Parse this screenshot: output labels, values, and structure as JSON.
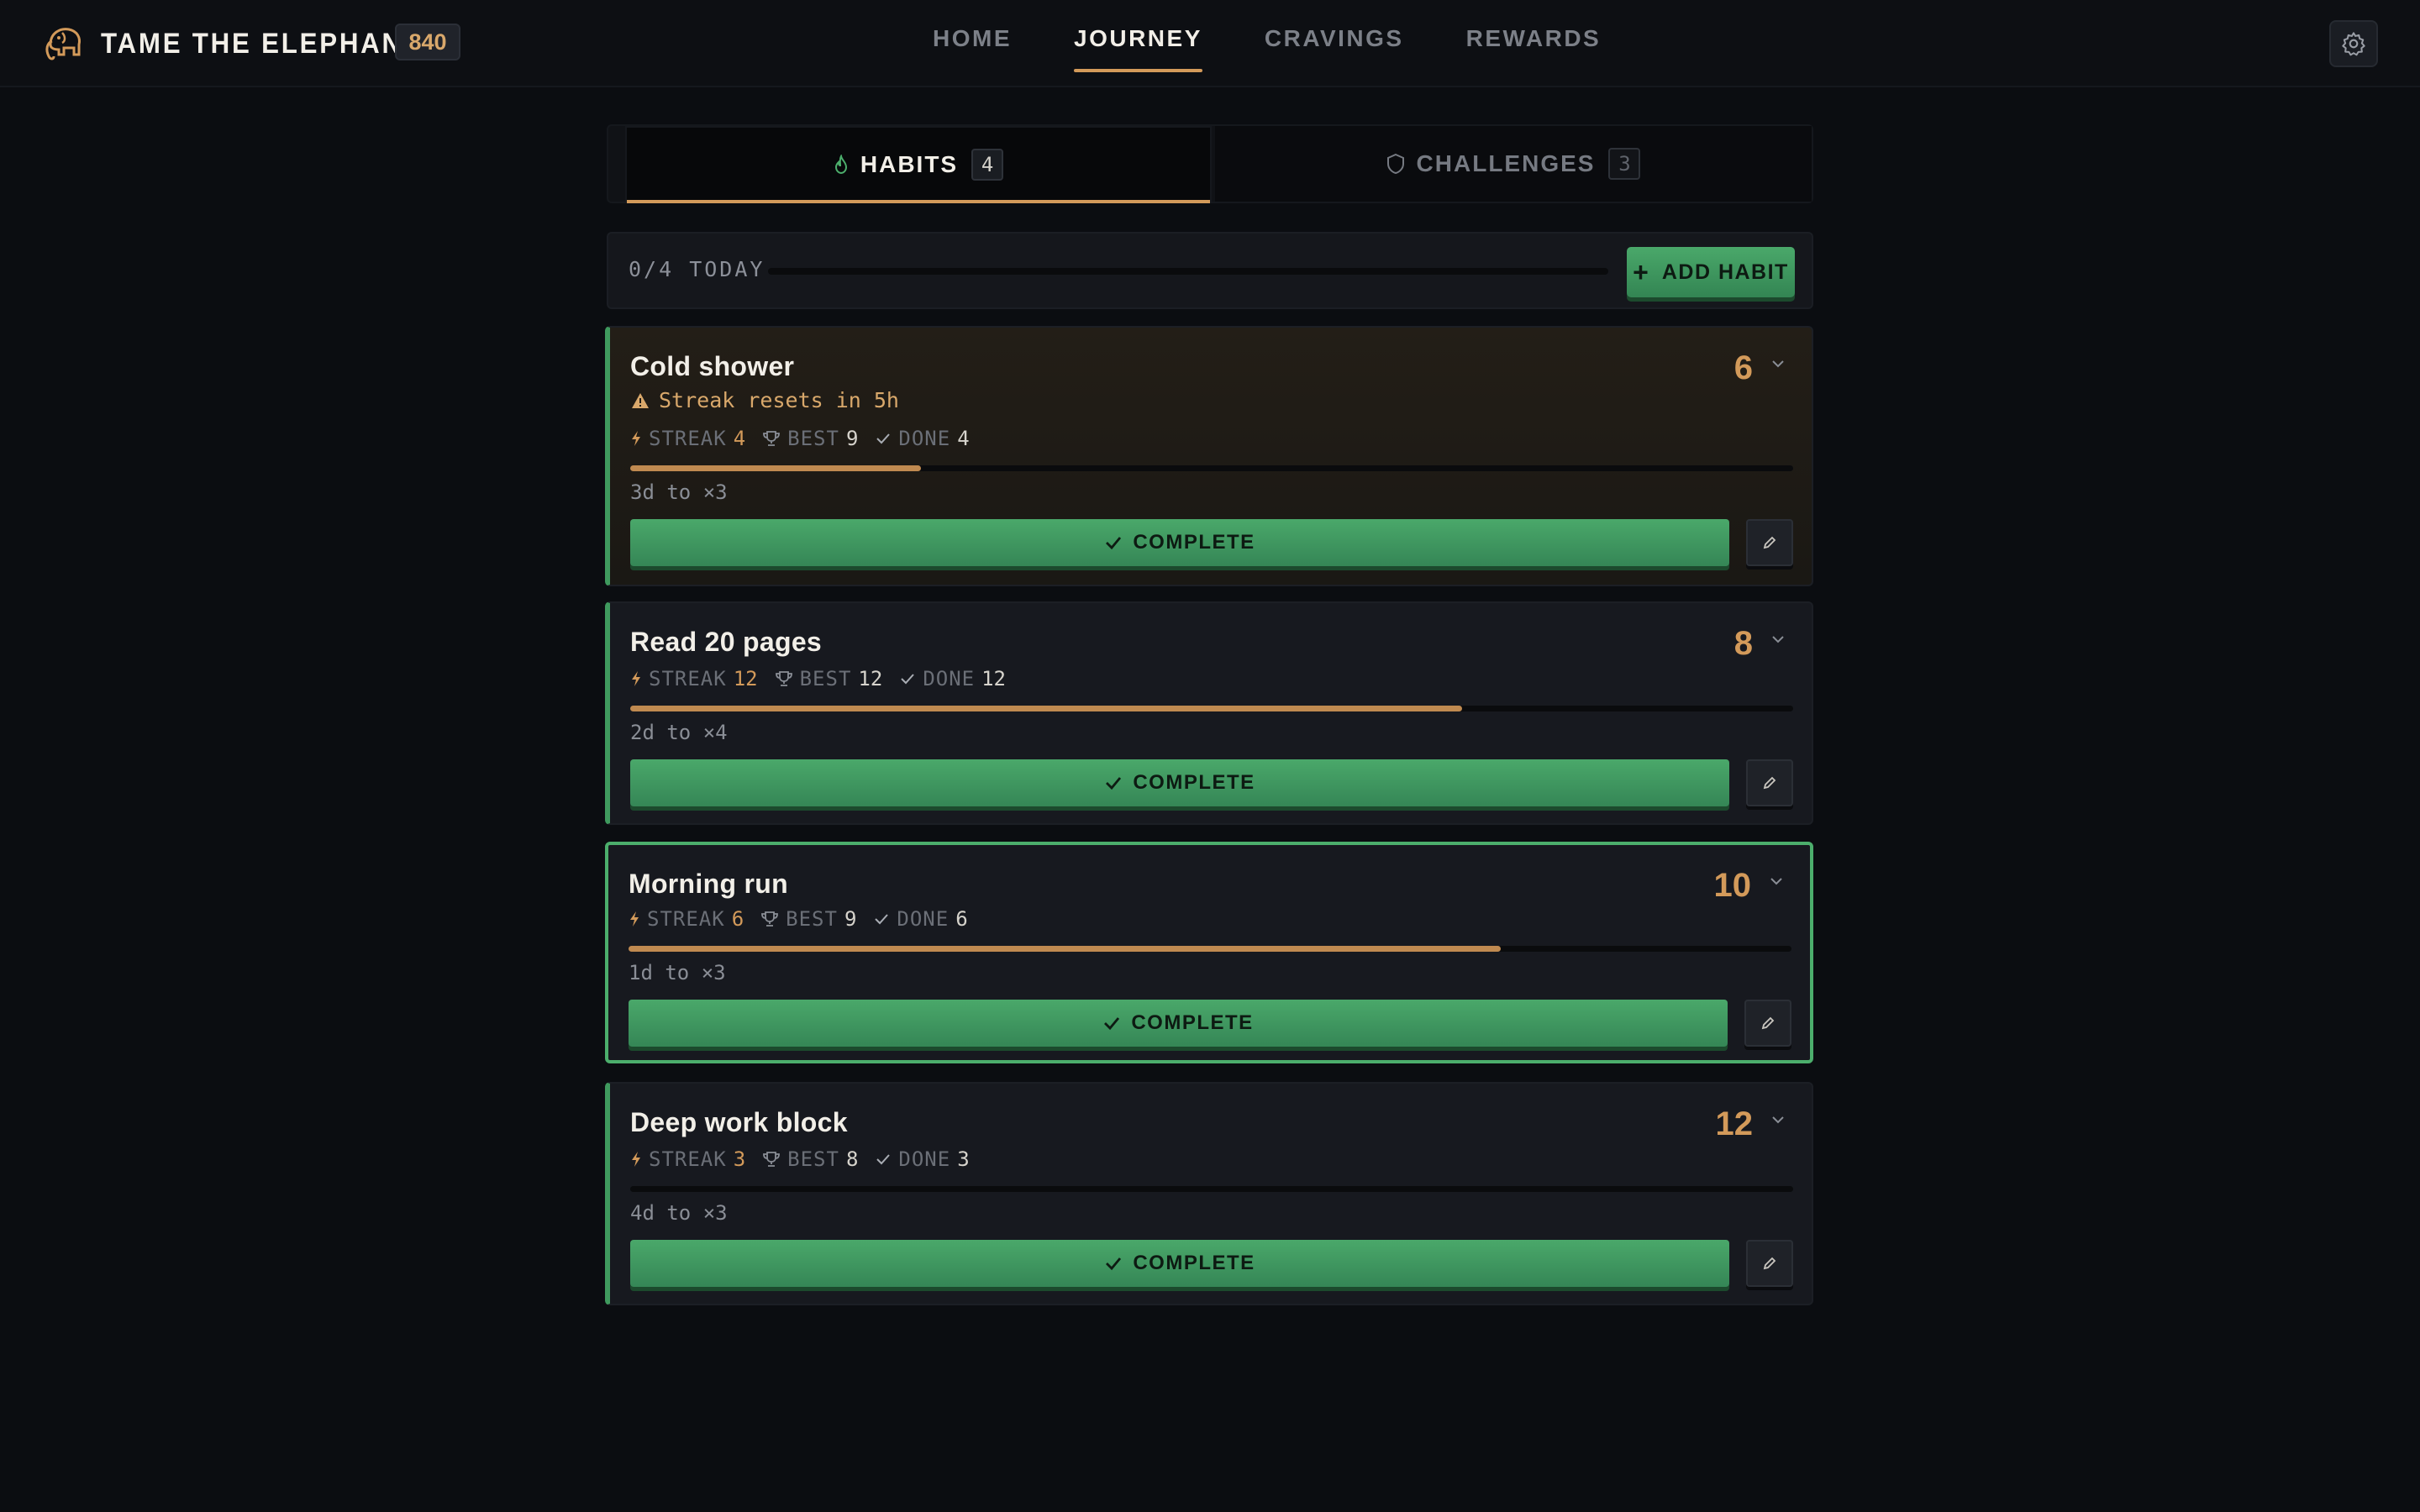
{
  "app": {
    "title": "TAME THE ELEPHANT",
    "points": "840",
    "logo_icon": "elephant-icon",
    "accent": "#d39a5a",
    "success": "#3f9a5e"
  },
  "nav": {
    "items": [
      {
        "label": "HOME",
        "active": false
      },
      {
        "label": "JOURNEY",
        "active": true
      },
      {
        "label": "CRAVINGS",
        "active": false
      },
      {
        "label": "REWARDS",
        "active": false
      }
    ],
    "settings_icon": "gear-icon"
  },
  "tabs": {
    "habits": {
      "label": "HABITS",
      "count": "4",
      "icon": "flame-icon",
      "active": true
    },
    "challenges": {
      "label": "CHALLENGES",
      "count": "3",
      "icon": "shield-icon",
      "active": false
    }
  },
  "today": {
    "label": "0/4 TODAY",
    "progress": 0,
    "add_label": "ADD HABIT"
  },
  "labels": {
    "streak": "STREAK",
    "best": "BEST",
    "done": "DONE",
    "complete": "COMPLETE"
  },
  "habits": [
    {
      "name": "Cold shower",
      "points": "6",
      "warning": "Streak resets in 5h",
      "streak": "4",
      "best": "9",
      "done": "4",
      "progress": 0.25,
      "multiplier": "3d to ×3"
    },
    {
      "name": "Read 20 pages",
      "points": "8",
      "streak": "12",
      "best": "12",
      "done": "12",
      "progress": 0.715,
      "multiplier": "2d to ×4"
    },
    {
      "name": "Morning run",
      "points": "10",
      "streak": "6",
      "best": "9",
      "done": "6",
      "progress": 0.75,
      "multiplier": "1d to ×3",
      "selected": true
    },
    {
      "name": "Deep work block",
      "points": "12",
      "streak": "3",
      "best": "8",
      "done": "3",
      "progress": 0,
      "multiplier": "4d to ×3"
    }
  ]
}
